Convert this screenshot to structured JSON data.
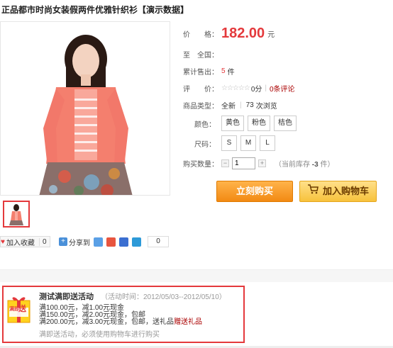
{
  "product": {
    "title": "正品都市时尚女装假两件优雅针织衫【演示数据】"
  },
  "price": {
    "label": "价　　格：",
    "value": "182.00",
    "unit": "元"
  },
  "shipping": {
    "label": "至　全国：",
    "value": ""
  },
  "sold": {
    "label": "累计售出：",
    "count": "5",
    "unit": "件"
  },
  "rating": {
    "label": "评　　价：",
    "stars": "☆☆☆☆☆",
    "score": "0分",
    "comments": "0条评论"
  },
  "category": {
    "label": "商品类型：",
    "value": "全新",
    "views": "73",
    "views_unit": "次浏览"
  },
  "colors": {
    "label": "颜色：",
    "options": [
      "黄色",
      "粉色",
      "桔色"
    ]
  },
  "sizes": {
    "label": "尺码：",
    "options": [
      "S",
      "M",
      "L"
    ]
  },
  "quantity": {
    "label": "购买数量：",
    "minus": "−",
    "plus": "+",
    "value": "1",
    "stock_prefix": "（当前库存",
    "stock_value": "-3",
    "stock_suffix": "件）"
  },
  "actions": {
    "buy_now": "立刻购买",
    "add_cart": "加入购物车"
  },
  "social": {
    "favorite": "加入收藏",
    "favorite_count": "0",
    "share": "分享到",
    "share_count": "0"
  },
  "promotion": {
    "badge_top": "满即",
    "badge_char": "送",
    "title": "测试满即送活动",
    "time": "（活动时间：2012/05/03--2012/05/10）",
    "rules": [
      "满100.00元，减1.00元现金",
      "满150.00元，减2.00元现金，包邮",
      "满200.00元，减3.00元现金，包邮，送礼品",
      "赠送礼品"
    ],
    "note": "满即送活动，必须使用购物车进行购买"
  },
  "colors_theme": {
    "accent": "#e4393c",
    "buy": "#f28a13",
    "cart": "#f7c23c"
  }
}
